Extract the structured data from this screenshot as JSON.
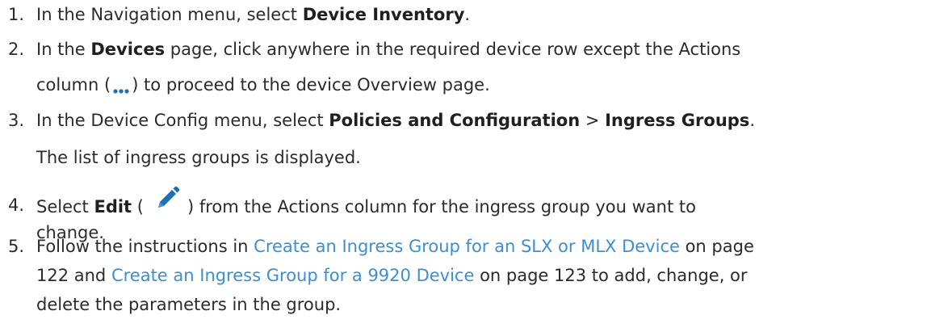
{
  "steps": [
    {
      "number": "1.",
      "lines": [
        {
          "a": "In the Navigation menu, select ",
          "bold": "Device Inventory",
          "b": "."
        }
      ]
    },
    {
      "number": "2.",
      "lines": [
        {
          "a": "In the ",
          "bold": "Devices",
          "b": " page, click anywhere in the required device row except the Actions"
        },
        {
          "a": "column (",
          "b": ") to proceed to the device Overview page.",
          "icon": "more-dots-icon"
        }
      ]
    },
    {
      "number": "3.",
      "lines": [
        {
          "a": "In the Device Config menu, select ",
          "bold1": "Policies and Configuration",
          "sep": " > ",
          "bold2": "Ingress Groups",
          "b": "."
        },
        {
          "a": "The list of ingress groups is displayed."
        }
      ]
    },
    {
      "number": "4.",
      "lines": [
        {
          "a": "Select ",
          "bold": "Edit",
          "b": " (",
          "c": ") from the Actions column for the ingress group you want to",
          "icon": "pencil-edit-icon"
        },
        {
          "a": "change."
        }
      ]
    },
    {
      "number": "5.",
      "lines": [
        {
          "a": "Follow the instructions in ",
          "link": "Create an Ingress Group for an SLX or MLX Device",
          "b": " on page"
        },
        {
          "a": "122 and ",
          "link": "Create an Ingress Group for a 9920 Device",
          "b": " on page 123 to add, change, or"
        },
        {
          "a": "delete the parameters in the group."
        }
      ]
    }
  ],
  "colors": {
    "text": "#2b2b2b",
    "link": "#3a8fd6",
    "icon": "#1f6fb5"
  }
}
